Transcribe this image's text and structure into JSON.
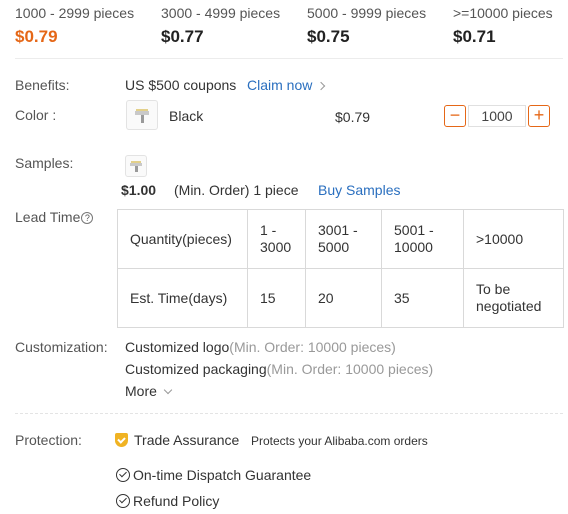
{
  "price_tiers": [
    {
      "range": "1000 - 2999 pieces",
      "price": "$0.79"
    },
    {
      "range": "3000 - 4999 pieces",
      "price": "$0.77"
    },
    {
      "range": "5000 - 9999 pieces",
      "price": "$0.75"
    },
    {
      "range": ">=10000 pieces",
      "price": "$0.71"
    }
  ],
  "colors": {
    "accent": "#e56717",
    "link": "#2a6fbf",
    "shield": "#f0b323"
  },
  "benefits": {
    "label": "Benefits:",
    "coupon": "US $500 coupons",
    "claim": "Claim now"
  },
  "color_row": {
    "label": "Color :",
    "name": "Black",
    "price": "$0.79",
    "quantity": "1000",
    "minus": "−",
    "plus": "+"
  },
  "samples": {
    "label": "Samples:",
    "price": "$1.00",
    "note": "(Min. Order) 1 piece",
    "buy": "Buy Samples"
  },
  "lead_time": {
    "label": "Lead Time",
    "help": "?",
    "rows": [
      [
        "Quantity(pieces)",
        "1 - 3000",
        "3001 - 5000",
        "5001 - 10000",
        ">10000"
      ],
      [
        "Est. Time(days)",
        "15",
        "20",
        "35",
        "To be negotiated"
      ]
    ]
  },
  "customization": {
    "label": "Customization:",
    "items": [
      {
        "name": "Customized logo",
        "min": "(Min. Order: 10000 pieces)"
      },
      {
        "name": "Customized packaging",
        "min": "(Min. Order: 10000 pieces)"
      }
    ],
    "more": "More"
  },
  "protection": {
    "label": "Protection:",
    "trade_assurance": "Trade Assurance",
    "trade_note": "Protects your Alibaba.com orders",
    "items": [
      "On-time Dispatch Guarantee",
      "Refund Policy"
    ]
  }
}
